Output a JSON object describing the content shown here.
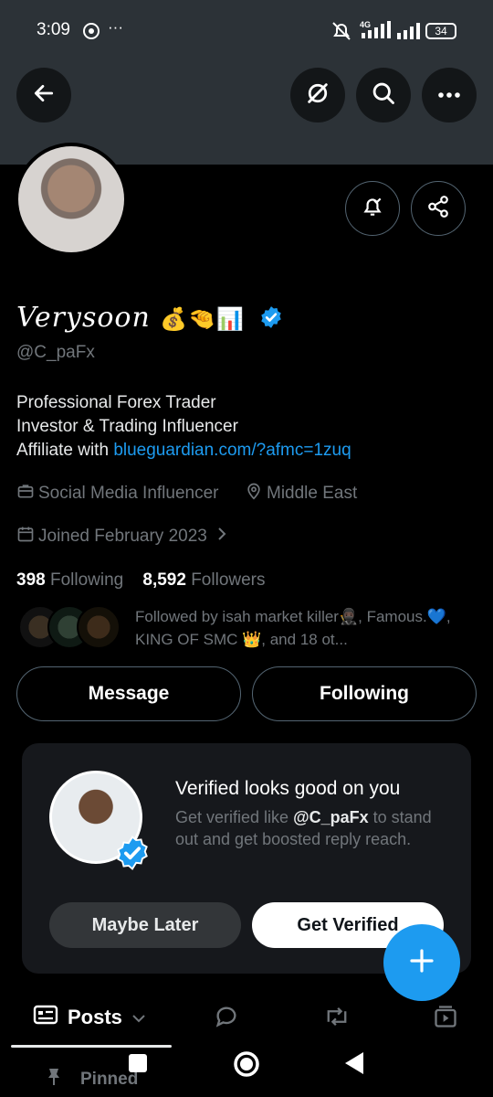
{
  "status_bar": {
    "time": "3:09",
    "more": "···",
    "network": "4G",
    "battery": "34"
  },
  "header": {
    "back_icon": "arrow-left-icon",
    "grok_icon": "grok-icon",
    "search_icon": "search-icon",
    "more_icon": "more-horizontal-icon"
  },
  "profile": {
    "display_name": "Verysoon",
    "emojis": "💰🤏📊",
    "handle": "@C_paFx",
    "bio_line1": "Professional Forex Trader",
    "bio_line2": "Investor & Trading Influencer",
    "bio_line3_prefix": "Affiliate with ",
    "bio_link": "blueguardian.com/?afmc=1zuq",
    "category": "Social Media Influencer",
    "location": "Middle East",
    "joined": "Joined February 2023",
    "following_count": "398",
    "following_label": "Following",
    "followers_count": "8,592",
    "followers_label": "Followers",
    "followed_by": "Followed by isah market killer🥷🏿, Famous.💙, KING OF SMC 👑, and 18 ot..."
  },
  "actions": {
    "message": "Message",
    "following": "Following"
  },
  "verify_card": {
    "title": "Verified looks good on you",
    "body_prefix": "Get verified like ",
    "body_handle": "@C_paFx",
    "body_suffix": " to stand out and get boosted reply reach.",
    "maybe_later": "Maybe Later",
    "get_verified": "Get Verified"
  },
  "tabs": {
    "posts": "Posts",
    "pinned": "Pinned"
  },
  "colors": {
    "accent": "#1d9bf0",
    "banner": "#2c3237",
    "muted": "#71767b"
  }
}
